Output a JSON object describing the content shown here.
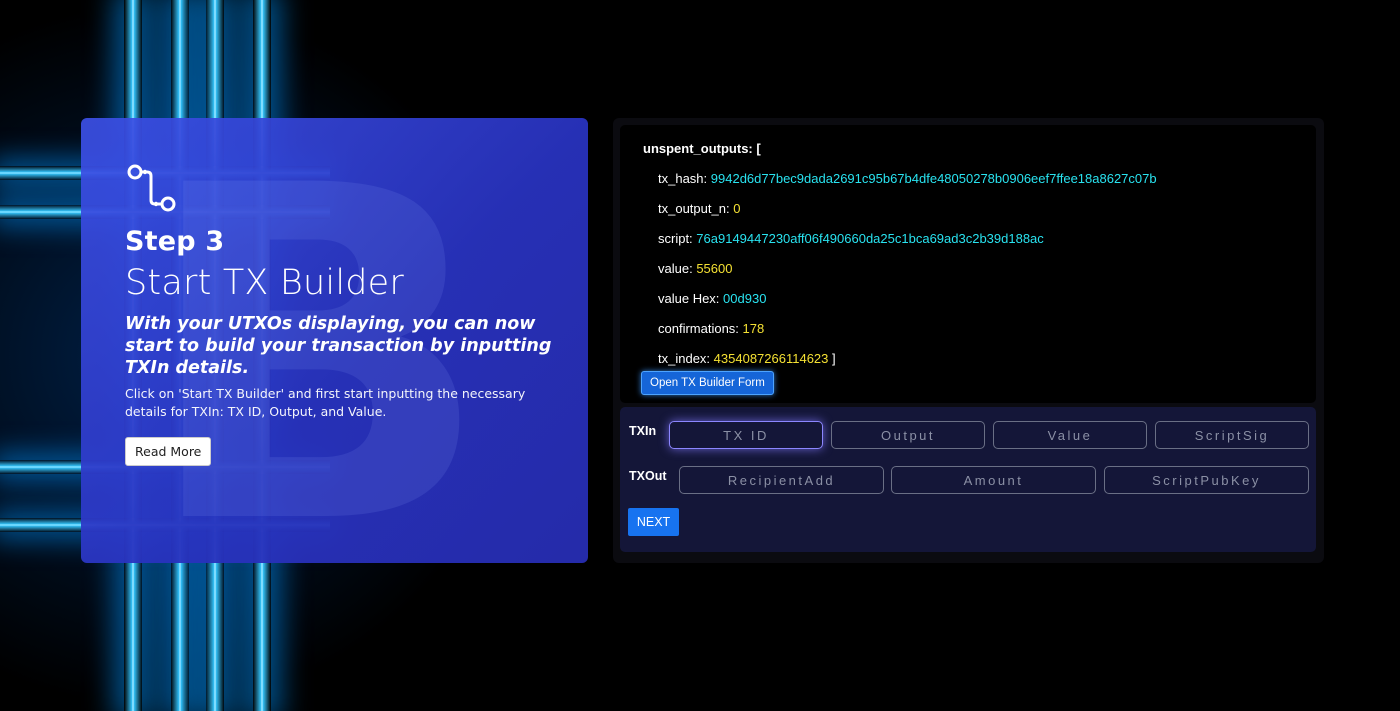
{
  "card": {
    "step": "Step 3",
    "title": "Start TX Builder",
    "lead": "With your UTXOs displaying, you can now start to build your transaction by inputting TXIn details.",
    "description": "Click on 'Start TX Builder' and first start inputting the necessary details for TXIn: TX ID, Output, and Value.",
    "read_more": "Read More",
    "icon": "route-icon",
    "watermark": "B"
  },
  "unspent": {
    "header": "unspent_outputs: [",
    "lines": [
      {
        "key": "tx_hash:",
        "value": "9942d6d77bec9dada2691c95b67b4dfe48050278b0906eef7ffee18a8627c07b",
        "kind": "hash"
      },
      {
        "key": "tx_output_n:",
        "value": "0",
        "kind": "num"
      },
      {
        "key": "script:",
        "value": "76a9149447230aff06f490660da25c1bca69ad3c2b39d188ac",
        "kind": "hash"
      },
      {
        "key": "value:",
        "value": "55600",
        "kind": "num"
      },
      {
        "key": "value Hex:",
        "value": "00d930",
        "kind": "hash"
      },
      {
        "key": "confirmations:",
        "value": "178",
        "kind": "num"
      },
      {
        "key": "tx_index:",
        "value": "4354087266114623",
        "kind": "num",
        "suffix": "]"
      }
    ],
    "open_button": "Open TX Builder Form"
  },
  "form": {
    "txin_label": "TXIn",
    "txin_fields": [
      "TX ID",
      "Output",
      "Value",
      "ScriptSig"
    ],
    "txout_label": "TXOut",
    "txout_fields": [
      "RecipientAdd",
      "Amount",
      "ScriptPubKey"
    ],
    "next": "NEXT"
  },
  "colors": {
    "hash": "#29e3f0",
    "number": "#f5e133",
    "accent": "#1773f0",
    "card": "#2f3cc8"
  }
}
